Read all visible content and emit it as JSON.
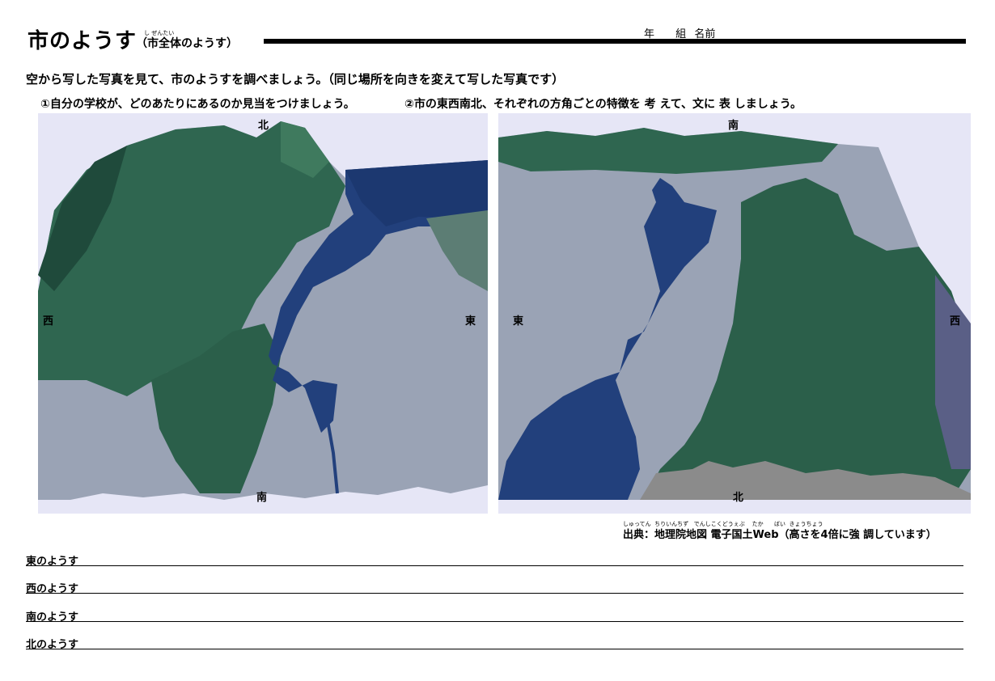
{
  "header": {
    "title": "市のようす",
    "subtitle": "（市全体のようす）",
    "subtitle_ruby": "し ぜんたい",
    "year_label": "年",
    "class_label": "組",
    "name_label": "名前"
  },
  "instruction": {
    "text": "空から写した写真を見て、市のようすを調べましょう。（同じ場所を向きを変えて写した写真です）"
  },
  "tasks": {
    "task1": "①自分の学校が、どのあたりにあるのか見当をつけましょう。",
    "task2": "②市の東西南北、それぞれの方角ごとの特徴を 考 えて、文に 表 しましょう。"
  },
  "left_photo": {
    "top": "北",
    "left": "西",
    "right": "東",
    "bottom": "南"
  },
  "right_photo": {
    "top": "南",
    "left": "東",
    "right": "西",
    "bottom": "北"
  },
  "source": {
    "text": "出典：地理院地図 電子国土Web（高さを4倍に強 調しています）",
    "ruby": "しゅってん  ちりいんちず   でんしこくどうぇぶ    たか      ばい  きょうちょう"
  },
  "answer_lines": [
    {
      "label": "東のようす"
    },
    {
      "label": "西のようす"
    },
    {
      "label": "南のようす"
    },
    {
      "label": "北のようす"
    }
  ],
  "colors": {
    "panel_bg": "#e6e6f6",
    "forest": "#2f6650",
    "forest_dark": "#1f4a3b",
    "urban": "#9aa3b5",
    "lake": "#22407c",
    "mountain_shadow": "#8b8b8b"
  }
}
